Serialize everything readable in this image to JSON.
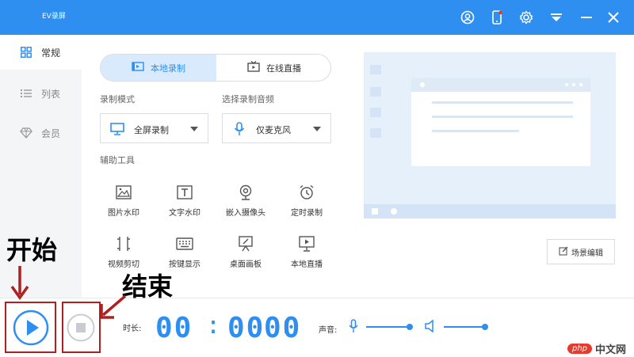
{
  "window": {
    "title": "EV录屏",
    "toolbar_icons": [
      "user-icon",
      "mobile-icon",
      "settings-icon",
      "dropdown-icon",
      "minimize-icon",
      "close-icon"
    ]
  },
  "sidebar": {
    "items": [
      {
        "label": "常规",
        "icon": "grid-icon",
        "active": true
      },
      {
        "label": "列表",
        "icon": "list-icon",
        "active": false
      },
      {
        "label": "会员",
        "icon": "diamond-icon",
        "active": false
      }
    ]
  },
  "mode_tabs": [
    {
      "label": "本地录制",
      "icon": "local-record-icon",
      "active": true
    },
    {
      "label": "在线直播",
      "icon": "live-tv-icon",
      "active": false
    }
  ],
  "record_mode": {
    "label": "录制模式",
    "value": "全屏录制",
    "icon": "monitor-icon"
  },
  "audio": {
    "label": "选择录制音频",
    "value": "仅麦克风",
    "icon": "microphone-icon"
  },
  "tools": {
    "label": "辅助工具",
    "items": [
      {
        "label": "图片水印",
        "icon": "image-icon"
      },
      {
        "label": "文字水印",
        "icon": "text-icon"
      },
      {
        "label": "嵌入摄像头",
        "icon": "webcam-icon"
      },
      {
        "label": "定时录制",
        "icon": "alarm-icon"
      },
      {
        "label": "视频剪切",
        "icon": "cut-icon"
      },
      {
        "label": "按键显示",
        "icon": "keyboard-icon"
      },
      {
        "label": "桌面画板",
        "icon": "easel-icon"
      },
      {
        "label": "本地直播",
        "icon": "presentation-icon"
      }
    ]
  },
  "scene_editor": {
    "label": "场景编辑",
    "icon": "edit-icon"
  },
  "bottom": {
    "duration_label": "时长:",
    "time": {
      "hh": "00",
      "mm": "00",
      "ss": "00"
    },
    "volume_label": "声音:",
    "mic_level": 1.0,
    "speaker_level": 1.0
  },
  "annotations": {
    "start": "开始",
    "stop": "结束"
  },
  "watermark": {
    "logo": "php",
    "text": "中文网"
  },
  "colors": {
    "accent": "#2e8ff0",
    "annotation_red": "#b02020"
  }
}
